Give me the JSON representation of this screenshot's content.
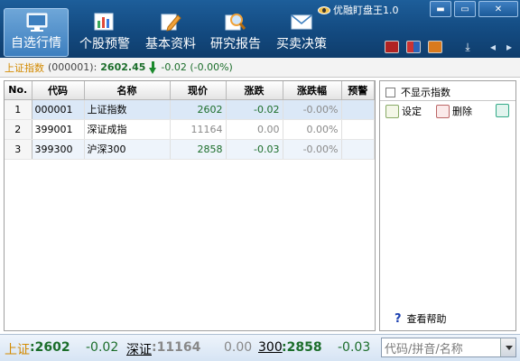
{
  "app": {
    "title": "优融盯盘王1.0"
  },
  "window": {
    "minimize": "▬",
    "restore": "▭",
    "close": "✕"
  },
  "nav": {
    "tabs": [
      {
        "label": "自选行情",
        "icon": "monitor-icon"
      },
      {
        "label": "个股预警",
        "icon": "bar-chart-icon"
      },
      {
        "label": "基本资料",
        "icon": "pencil-icon"
      },
      {
        "label": "研究报告",
        "icon": "magnifier-icon"
      },
      {
        "label": "买卖决策",
        "icon": "envelope-icon"
      }
    ]
  },
  "index_bar": {
    "name": "上证指数",
    "code": "(000001):",
    "price": "2602.45",
    "change": "-0.02 (-0.00%)"
  },
  "table": {
    "headers": [
      "No.",
      "代码",
      "名称",
      "现价",
      "涨跌",
      "涨跌幅",
      "预警"
    ],
    "rows": [
      {
        "no": "1",
        "code": "000001",
        "name": "上证指数",
        "price": "2602",
        "change": "-0.02",
        "pct": "-0.00%",
        "warn": ""
      },
      {
        "no": "2",
        "code": "399001",
        "name": "深证成指",
        "price": "11164",
        "change": "0.00",
        "pct": "0.00%",
        "warn": ""
      },
      {
        "no": "3",
        "code": "399300",
        "name": "沪深300",
        "price": "2858",
        "change": "-0.03",
        "pct": "-0.00%",
        "warn": ""
      }
    ]
  },
  "right_panel": {
    "hide_index_label": "不显示指数",
    "set_label": "设定",
    "delete_label": "删除",
    "help_label": "查看帮助"
  },
  "status_bar": {
    "sh_label": "上证",
    "sh_value": ":2602",
    "sh_change": "-0.02",
    "sz_label": "深证",
    "sz_value": ":11164",
    "sz_change": "0.00",
    "hs_label": "300",
    "hs_value": ":2858",
    "hs_change": "-0.03",
    "search_placeholder": "代码/拼音/名称"
  }
}
